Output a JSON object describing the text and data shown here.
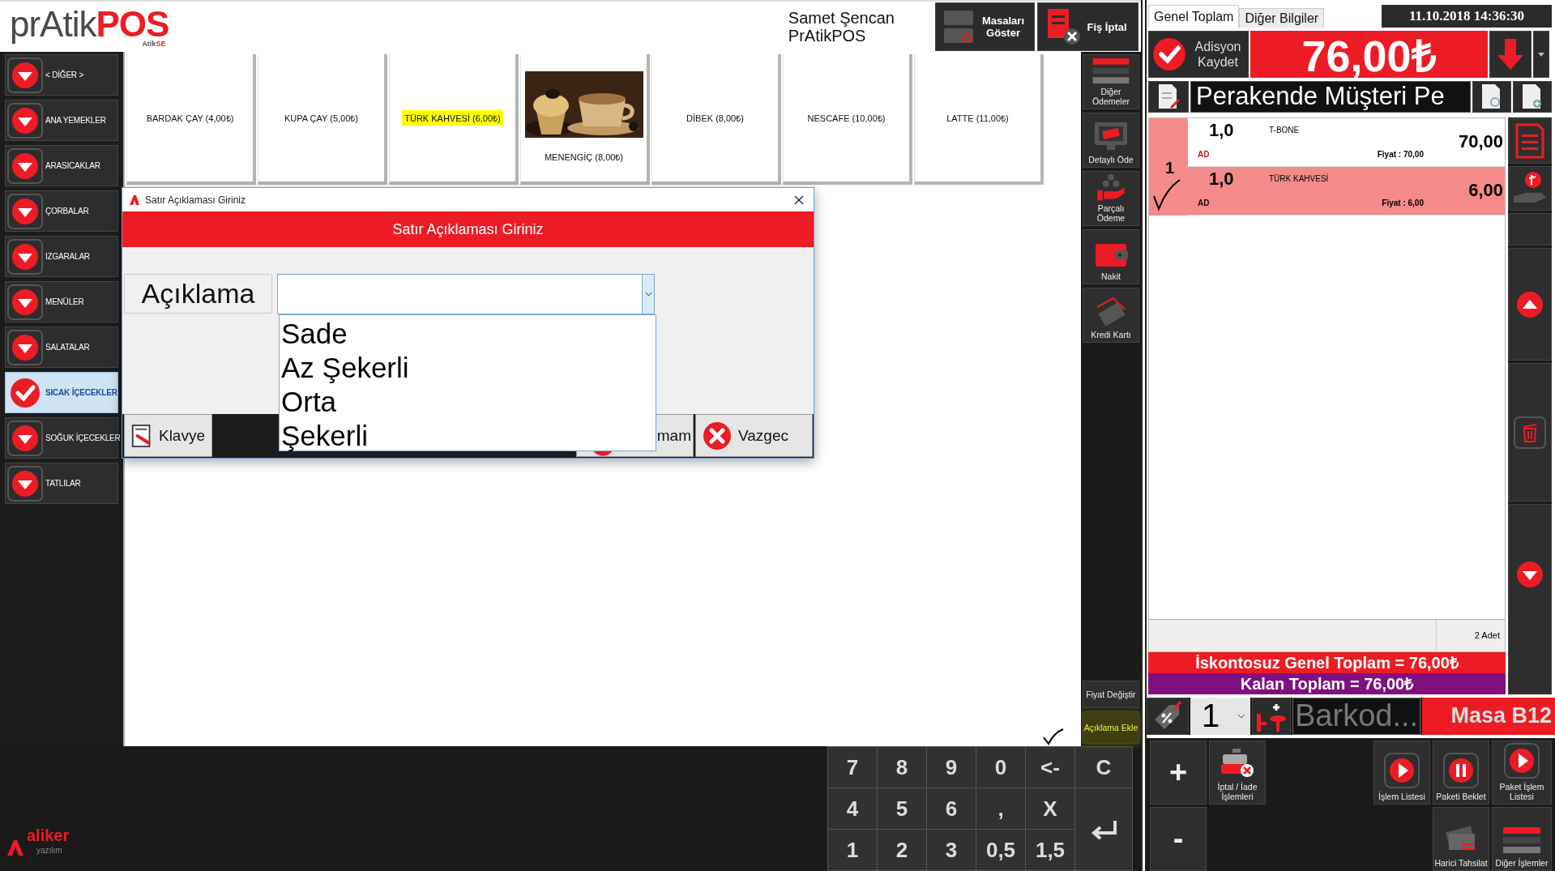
{
  "header": {
    "logo": {
      "main": "prAtik",
      "accent": "POS",
      "sub": "Atik",
      "sub_accent": "SE"
    },
    "user": {
      "name": "Samet Şencan",
      "company": "PrAtikPOS"
    },
    "buttons": [
      {
        "label": "Masaları Göster",
        "kind": "tables"
      },
      {
        "label": "Fiş İptal",
        "kind": "cancel"
      }
    ]
  },
  "categories": [
    {
      "label": "< DİĞER >",
      "selected": false
    },
    {
      "label": "ANA YEMEKLER",
      "selected": false
    },
    {
      "label": "ARASICAKLAR",
      "selected": false
    },
    {
      "label": "ÇORBALAR",
      "selected": false
    },
    {
      "label": "IZGARALAR",
      "selected": false
    },
    {
      "label": "MENÜLER",
      "selected": false
    },
    {
      "label": "SALATALAR",
      "selected": false
    },
    {
      "label": "SICAK İÇECEKLER",
      "selected": true
    },
    {
      "label": "SOĞUK İÇECEKLER",
      "selected": false
    },
    {
      "label": "TATLILAR",
      "selected": false
    }
  ],
  "products": [
    {
      "label": "BARDAK ÇAY (4,00₺)",
      "kind": "text",
      "highlighted": false
    },
    {
      "label": "KUPA ÇAY (5,00₺)",
      "kind": "text",
      "highlighted": false
    },
    {
      "label": "TÜRK KAHVESİ (6,00₺)",
      "kind": "text",
      "highlighted": true
    },
    {
      "label": "MENENGİÇ (8,00₺)",
      "kind": "picture",
      "highlighted": false
    },
    {
      "label": "DİBEK (8,00₺)",
      "kind": "text",
      "highlighted": false
    },
    {
      "label": "NESCAFE (10,00₺)",
      "kind": "text",
      "highlighted": false
    },
    {
      "label": "LATTE (11,00₺)",
      "kind": "text",
      "highlighted": false
    }
  ],
  "actions": [
    {
      "label": "Diğer Ödemeler",
      "kind": "other"
    },
    {
      "label": "Detaylı Öde",
      "kind": "detail"
    },
    {
      "label": "Parçalı Ödeme",
      "kind": "split"
    },
    {
      "label": "Nakit",
      "kind": "cash"
    },
    {
      "label": "Kredi Kartı",
      "kind": "card"
    }
  ],
  "side_buttons": [
    {
      "label": "Fiyat Değiştir",
      "highlighted": false
    },
    {
      "label": "Açıklama Ekle",
      "highlighted": true
    }
  ],
  "dialog": {
    "title": "Satır Açıklaması Giriniz",
    "heading": "Satır Açıklaması Giriniz",
    "label": "Açıklama",
    "options": [
      "Sade",
      "Az Şekerli",
      "Orta",
      "Şekerli"
    ],
    "buttons": [
      {
        "label": "Klavye",
        "kind": "keyboard"
      },
      {
        "label": "mam",
        "kind": "ok"
      },
      {
        "label": "Vazgec",
        "kind": "cancel"
      }
    ]
  },
  "keypad": [
    "7",
    "8",
    "9",
    "0",
    "<-",
    "C",
    "4",
    "5",
    "6",
    ",",
    "X",
    "1",
    "2",
    "3",
    "0,5",
    "1,5"
  ],
  "footer_logo": {
    "name": "aliker",
    "tagline": "yazılım"
  },
  "right": {
    "tabs": [
      {
        "label": "Genel Toplam",
        "selected": true
      },
      {
        "label": "Diğer Bilgiler",
        "selected": false
      }
    ],
    "datetime": "11.10.2018 14:36:30",
    "save_button": "Adisyon Kaydet",
    "total": "76,00₺",
    "customer": "Perakende Müşteri Pe",
    "order": {
      "group": "1",
      "items": [
        {
          "qty": "1,0",
          "name": "T-BONE",
          "note": "AD",
          "price": "Fiyat : 70,00",
          "total": "70,00",
          "selected": false
        },
        {
          "qty": "1,0",
          "name": "TÜRK KAHVESİ",
          "note": "AD",
          "price": "Fiyat : 6,00",
          "total": "6,00",
          "selected": true
        }
      ]
    },
    "count": "2 Adet",
    "undiscounted_total": "İskontosuz Genel Toplam = 76,00₺",
    "remaining_total": "Kalan Toplam = 76,00₺",
    "quantity": "1",
    "barcode": {
      "placeholder": "Barkod..."
    },
    "table": "Masa B12",
    "buttons": [
      {
        "label": "+",
        "kind": "plus"
      },
      {
        "label": "-",
        "kind": "minus"
      },
      {
        "label": "İptal / İade İşlemleri",
        "kind": "refund"
      },
      {
        "label": "İşlem Listesi",
        "kind": "play"
      },
      {
        "label": "Paketi Beklet",
        "kind": "pause"
      },
      {
        "label": "Paket İşlem Listesi",
        "kind": "play"
      },
      {
        "label": "Harici Tahsilat",
        "kind": "collect"
      },
      {
        "label": "Diğer İşlemler",
        "kind": "bars"
      }
    ]
  }
}
